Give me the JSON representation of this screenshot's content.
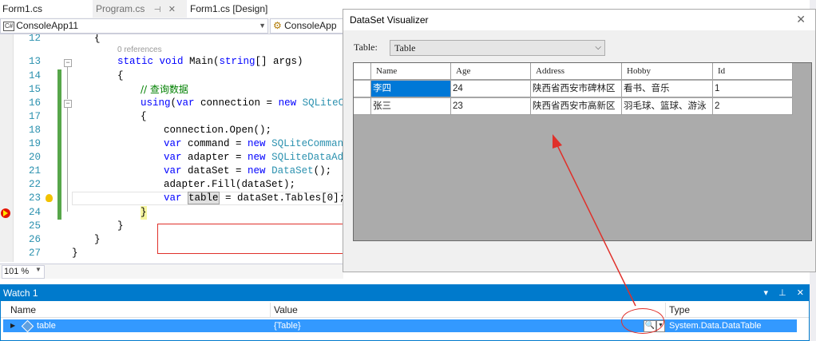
{
  "tabs": [
    {
      "label": "Form1.cs"
    },
    {
      "label": "Program.cs"
    },
    {
      "label": "Form1.cs [Design]"
    }
  ],
  "tab_pin_icon": "pin-icon",
  "tab_close_icon": "close-icon",
  "nav": {
    "project": "ConsoleApp11",
    "class": "ConsoleApp"
  },
  "editor": {
    "references": "0 references",
    "lines": [
      {
        "n": "12",
        "code": "{"
      },
      {
        "n": "13",
        "code": "static void Main(string[] args)"
      },
      {
        "n": "14",
        "code": "{"
      },
      {
        "n": "15",
        "code": "// 查询数据"
      },
      {
        "n": "16",
        "code": "using(var connection = new SQLiteCo"
      },
      {
        "n": "17",
        "code": "{"
      },
      {
        "n": "18",
        "code": "connection.Open();"
      },
      {
        "n": "19",
        "code": "var command = new SQLiteCommand"
      },
      {
        "n": "20",
        "code": "var adapter = new SQLiteDataAda"
      },
      {
        "n": "21",
        "code": "var dataSet = new DataSet();"
      },
      {
        "n": "22",
        "code": "adapter.Fill(dataSet);"
      },
      {
        "n": "23",
        "code": "var table = dataSet.Tables[0];"
      },
      {
        "n": "24",
        "code": "}"
      },
      {
        "n": "25",
        "code": "}"
      },
      {
        "n": "26",
        "code": "}"
      },
      {
        "n": "27",
        "code": "}"
      }
    ]
  },
  "zoom": "101 %",
  "watch": {
    "title": "Watch 1",
    "columns": {
      "name": "Name",
      "value": "Value",
      "type": "Type"
    },
    "row": {
      "name": "table",
      "value": "{Table}",
      "type": "System.Data.DataTable"
    }
  },
  "visualizer": {
    "title": "DataSet Visualizer",
    "table_label": "Table:",
    "selected_table": "Table",
    "columns": [
      "Name",
      "Age",
      "Address",
      "Hobby",
      "Id"
    ],
    "rows": [
      [
        "李四",
        "24",
        "陕西省西安市碑林区",
        "看书、音乐",
        "1"
      ],
      [
        "张三",
        "23",
        "陕西省西安市高新区",
        "羽毛球、篮球、游泳",
        "2"
      ]
    ]
  },
  "colors": {
    "accent": "#007acc",
    "selection": "#3399ff",
    "annotation": "#e0302a"
  }
}
